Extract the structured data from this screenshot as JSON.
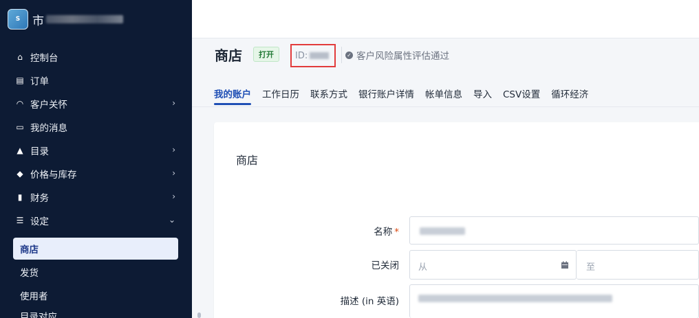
{
  "brand": {
    "name_prefix": "市",
    "logo_text": "S"
  },
  "sidebar": {
    "items": [
      {
        "label": "控制台",
        "icon": "home-icon",
        "glyph": "⌂",
        "chevron": ""
      },
      {
        "label": "订单",
        "icon": "receipt-icon",
        "glyph": "▤",
        "chevron": ""
      },
      {
        "label": "客户关怀",
        "icon": "headset-icon",
        "glyph": "◠",
        "chevron": "›"
      },
      {
        "label": "我的消息",
        "icon": "message-icon",
        "glyph": "▭",
        "chevron": ""
      },
      {
        "label": "目录",
        "icon": "shapes-icon",
        "glyph": "▲",
        "chevron": "›"
      },
      {
        "label": "价格与库存",
        "icon": "tag-icon",
        "glyph": "◆",
        "chevron": "›"
      },
      {
        "label": "财务",
        "icon": "invoice-icon",
        "glyph": "▮",
        "chevron": "›"
      },
      {
        "label": "设定",
        "icon": "sliders-icon",
        "glyph": "☰",
        "chevron": "⌄"
      }
    ],
    "sub_items": [
      {
        "label": "商店",
        "active": true
      },
      {
        "label": "发货",
        "active": false
      },
      {
        "label": "使用者",
        "active": false
      },
      {
        "label": "目录对应",
        "active": false
      }
    ]
  },
  "header": {
    "title": "商店",
    "status_badge": "打开",
    "id_label": "ID:",
    "verify_text": "客户风险属性评估通过"
  },
  "tabs": [
    "我的账户",
    "工作日历",
    "联系方式",
    "银行账户详情",
    "帐单信息",
    "导入",
    "CSV设置",
    "循环经济"
  ],
  "form": {
    "section_title": "商店",
    "name_label": "名称",
    "required_mark": "*",
    "closed_label": "已关闭",
    "from_placeholder": "从",
    "to_placeholder": "至",
    "description_label": "描述 (in 英语)"
  }
}
